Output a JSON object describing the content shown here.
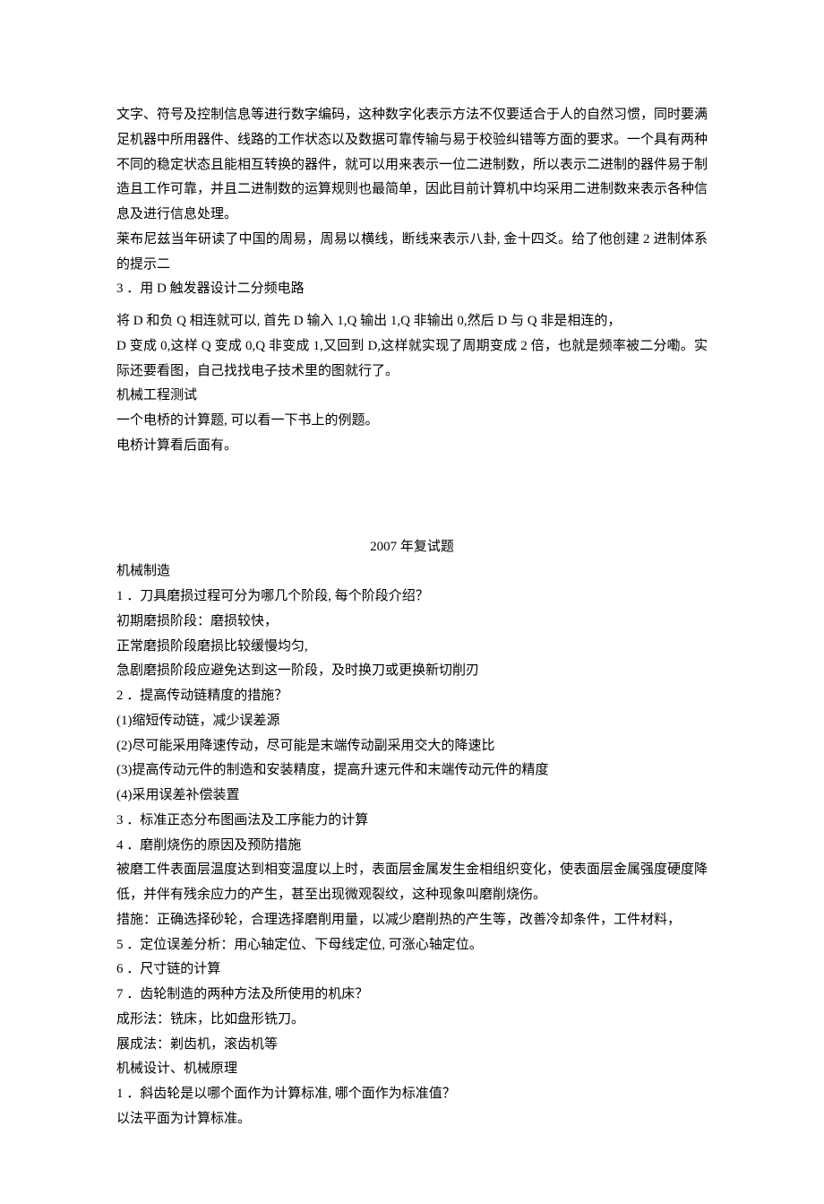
{
  "p1": "文字、符号及控制信息等进行数字编码，这种数字化表示方法不仅要适合于人的自然习惯，同时要满足机器中所用器件、线路的工作状态以及数据可靠传输与易于校验纠错等方面的要求。一个具有两种不同的稳定状态且能相互转换的器件，就可以用来表示一位二进制数，所以表示二进制的器件易于制造且工作可靠，并且二进制数的运算规则也最简单，因此目前计算机中均采用二进制数来表示各种信息及进行信息处理。",
  "p2": "莱布尼兹当年研读了中国的周易，周易以横线，断线来表示八卦, 金十四爻。给了他创建 2 进制体系的提示二",
  "p3": "3 ．用 D 触发器设计二分频电路",
  "p4": "将 D 和负 Q 相连就可以, 首先 D 输入 1,Q 输出 1,Q 非输出 0,然后 D 与 Q 非是相连的，",
  "p5": "D 变成 0,这样 Q 变成 0,Q 非变成 1,又回到 D,这样就实现了周期变成 2 倍，也就是频率被二分嘞。实际还要看图，自己找找电子技术里的图就行了。",
  "p6": "机械工程测试",
  "p7": "一个电桥的计算题, 可以看一下书上的例题。",
  "p8": "电桥计算看后面有。",
  "h1": "2007 年复试题",
  "p9": "机械制造",
  "p10": "1 ．刀具磨损过程可分为哪几个阶段, 每个阶段介绍？",
  "p11": "初期磨损阶段：磨损较快，",
  "p12": "正常磨损阶段磨损比较缓慢均匀,",
  "p13": "急剧磨损阶段应避免达到这一阶段，及时换刀或更换新切削刃",
  "p14": "2 ．提高传动链精度的措施？",
  "p15": "(1)缩短传动链，减少误差源",
  "p16": "(2)尽可能采用降速传动，尽可能是末端传动副采用交大的降速比",
  "p17": "(3)提高传动元件的制造和安装精度，提高升速元件和末端传动元件的精度",
  "p18": "(4)采用误差补偿装置",
  "p19": "3 ．标准正态分布图画法及工序能力的计算",
  "p20": "4 ．磨削烧伤的原因及预防措施",
  "p21": "被磨工件表面层温度达到相变温度以上时，表面层金属发生金相组织变化，使表面层金属强度硬度降低，并伴有残余应力的产生，甚至出现微观裂纹，这种现象叫磨削烧伤。",
  "p22": "措施：正确选择砂轮，合理选择磨削用量，以减少磨削热的产生等，改善冷却条件，工件材料，",
  "p23": "5 ．定位误差分析：用心轴定位、下母线定位, 可涨心轴定位。",
  "p24": "6 ．尺寸链的计算",
  "p25": "7 ．齿轮制造的两种方法及所使用的机床？",
  "p26": "成形法：铣床，比如盘形铣刀。",
  "p27": "展成法：剃齿机，滚齿机等",
  "p28": "机械设计、机械原理",
  "p29": "1 ．斜齿轮是以哪个面作为计算标准, 哪个面作为标准值？",
  "p30": "以法平面为计算标准。"
}
